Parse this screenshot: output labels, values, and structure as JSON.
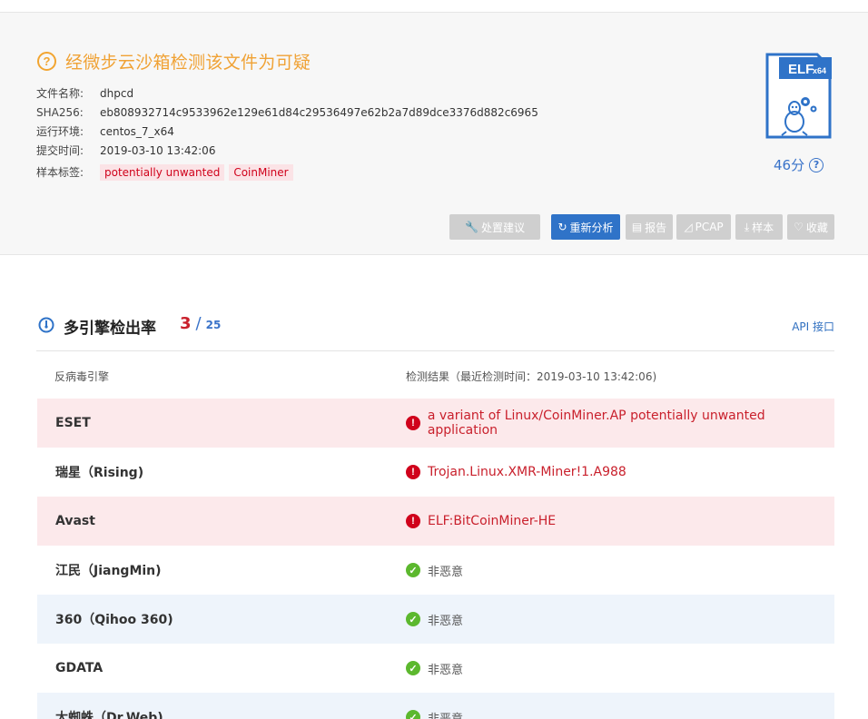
{
  "summary": {
    "verdict": "经微步云沙箱检测该文件为可疑",
    "info": [
      {
        "label": "文件名称:",
        "value": "dhpcd"
      },
      {
        "label": "SHA256:",
        "value": "eb808932714c9533962e129e61d84c29536497e62b2a7d89dce3376d882c6965"
      },
      {
        "label": "运行环境:",
        "value": "centos_7_x64"
      },
      {
        "label": "提交时间:",
        "value": "2019-03-10 13:42:06"
      }
    ],
    "tags_label": "样本标签:",
    "tags": [
      "potentially unwanted",
      "CoinMiner"
    ],
    "filetype": {
      "badge": "ELF",
      "arch": "x64"
    },
    "score": "46分"
  },
  "actions": {
    "advice": "处置建议",
    "reanalyze": "重新分析",
    "report": "报告",
    "pcap": "PCAP",
    "sample": "样本",
    "favorite": "收藏"
  },
  "detection": {
    "title": "多引擎检出率",
    "detected": "3",
    "slash": "/",
    "total": "25",
    "api_link": "API 接口",
    "col_engine": "反病毒引擎",
    "col_result": "检测结果（最近检测时间：2019-03-10 13:42:06)",
    "rows": [
      {
        "engine": "ESET",
        "result": "a variant of Linux/CoinMiner.AP potentially unwanted application",
        "malicious": true
      },
      {
        "engine": "瑞星（Rising)",
        "result": "Trojan.Linux.XMR-Miner!1.A988",
        "malicious": true
      },
      {
        "engine": "Avast",
        "result": "ELF:BitCoinMiner-HE",
        "malicious": true
      },
      {
        "engine": "江民（JiangMin)",
        "result": "非恶意",
        "malicious": false
      },
      {
        "engine": "360（Qihoo 360)",
        "result": "非恶意",
        "malicious": false
      },
      {
        "engine": "GDATA",
        "result": "非恶意",
        "malicious": false
      },
      {
        "engine": "大蜘蛛（Dr.Web)",
        "result": "非恶意",
        "malicious": false
      }
    ]
  },
  "colors": {
    "warning": "#f0a235",
    "danger": "#d0021b",
    "primary": "#2f73c8",
    "safe": "#5cb82e"
  }
}
